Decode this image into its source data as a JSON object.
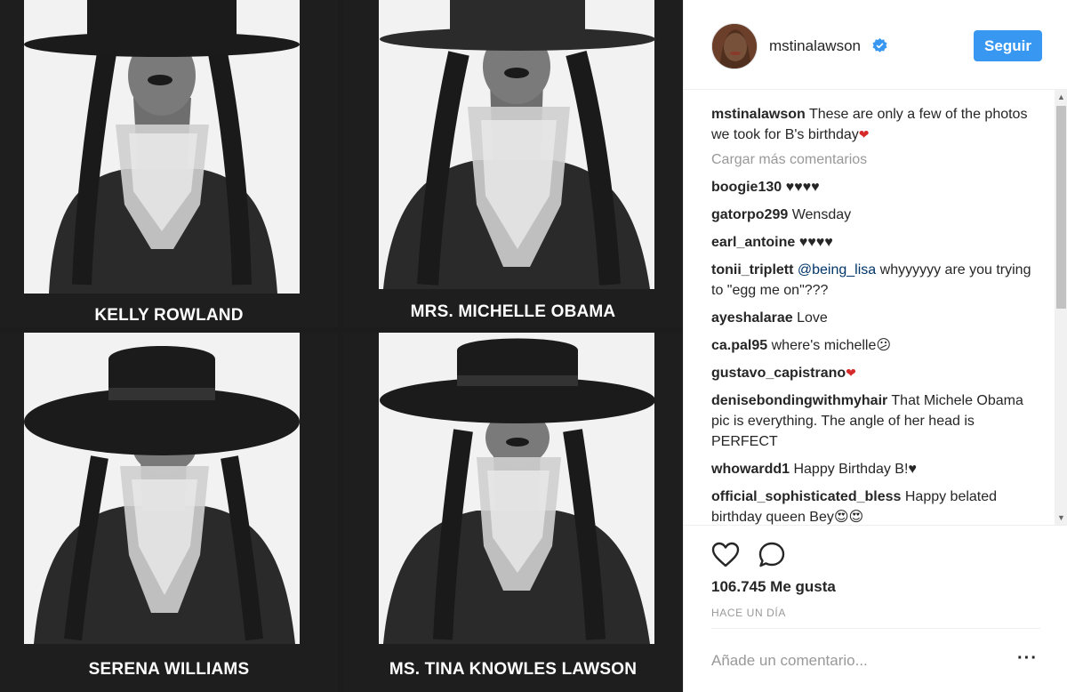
{
  "photo": {
    "panels": [
      {
        "caption": "KELLY ROWLAND"
      },
      {
        "caption": "MRS. MICHELLE OBAMA"
      },
      {
        "caption": "SERENA WILLIAMS"
      },
      {
        "caption": "MS. TINA KNOWLES LAWSON"
      }
    ]
  },
  "post": {
    "username": "mstinalawson",
    "verified_icon": "verified-badge-icon",
    "follow_label": "Seguir",
    "caption": {
      "user": "mstinalawson",
      "text": "These are only a few of the photos we took for B's birthday",
      "emoji": "❤"
    },
    "load_more": "Cargar más comentarios",
    "comments": [
      {
        "user": "boogie130",
        "text": "♥♥♥♥"
      },
      {
        "user": "gatorpo299",
        "text": "Wensday"
      },
      {
        "user": "earl_antoine",
        "text": "♥♥♥♥"
      },
      {
        "user": "tonii_triplett",
        "mention": "@being_lisa",
        "text": "whyyyyyy are you trying to \"egg me on\"???"
      },
      {
        "user": "ayeshalarae",
        "text": "Love"
      },
      {
        "user": "ca.pal95",
        "text": "where's michelle",
        "emoji": "😕"
      },
      {
        "user": "gustavo_capistrano",
        "text": "",
        "emoji": "❤"
      },
      {
        "user": "denisebondingwithmyhair",
        "text": "That Michele Obama pic is everything. The angle of her head is PERFECT"
      },
      {
        "user": "whowardd1",
        "text": "Happy Birthday B!♥"
      },
      {
        "user": "official_sophisticated_bless",
        "text": "Happy belated birthday queen Bey",
        "emoji": "😍😍"
      }
    ],
    "likes": "106.745 Me gusta",
    "time": "HACE UN DÍA",
    "add_comment_placeholder": "Añade un comentario...",
    "more_label": "···"
  },
  "colors": {
    "accent": "#3897f0",
    "verified": "#3897f0",
    "muted": "#999999",
    "heart": "#d62a2a"
  }
}
